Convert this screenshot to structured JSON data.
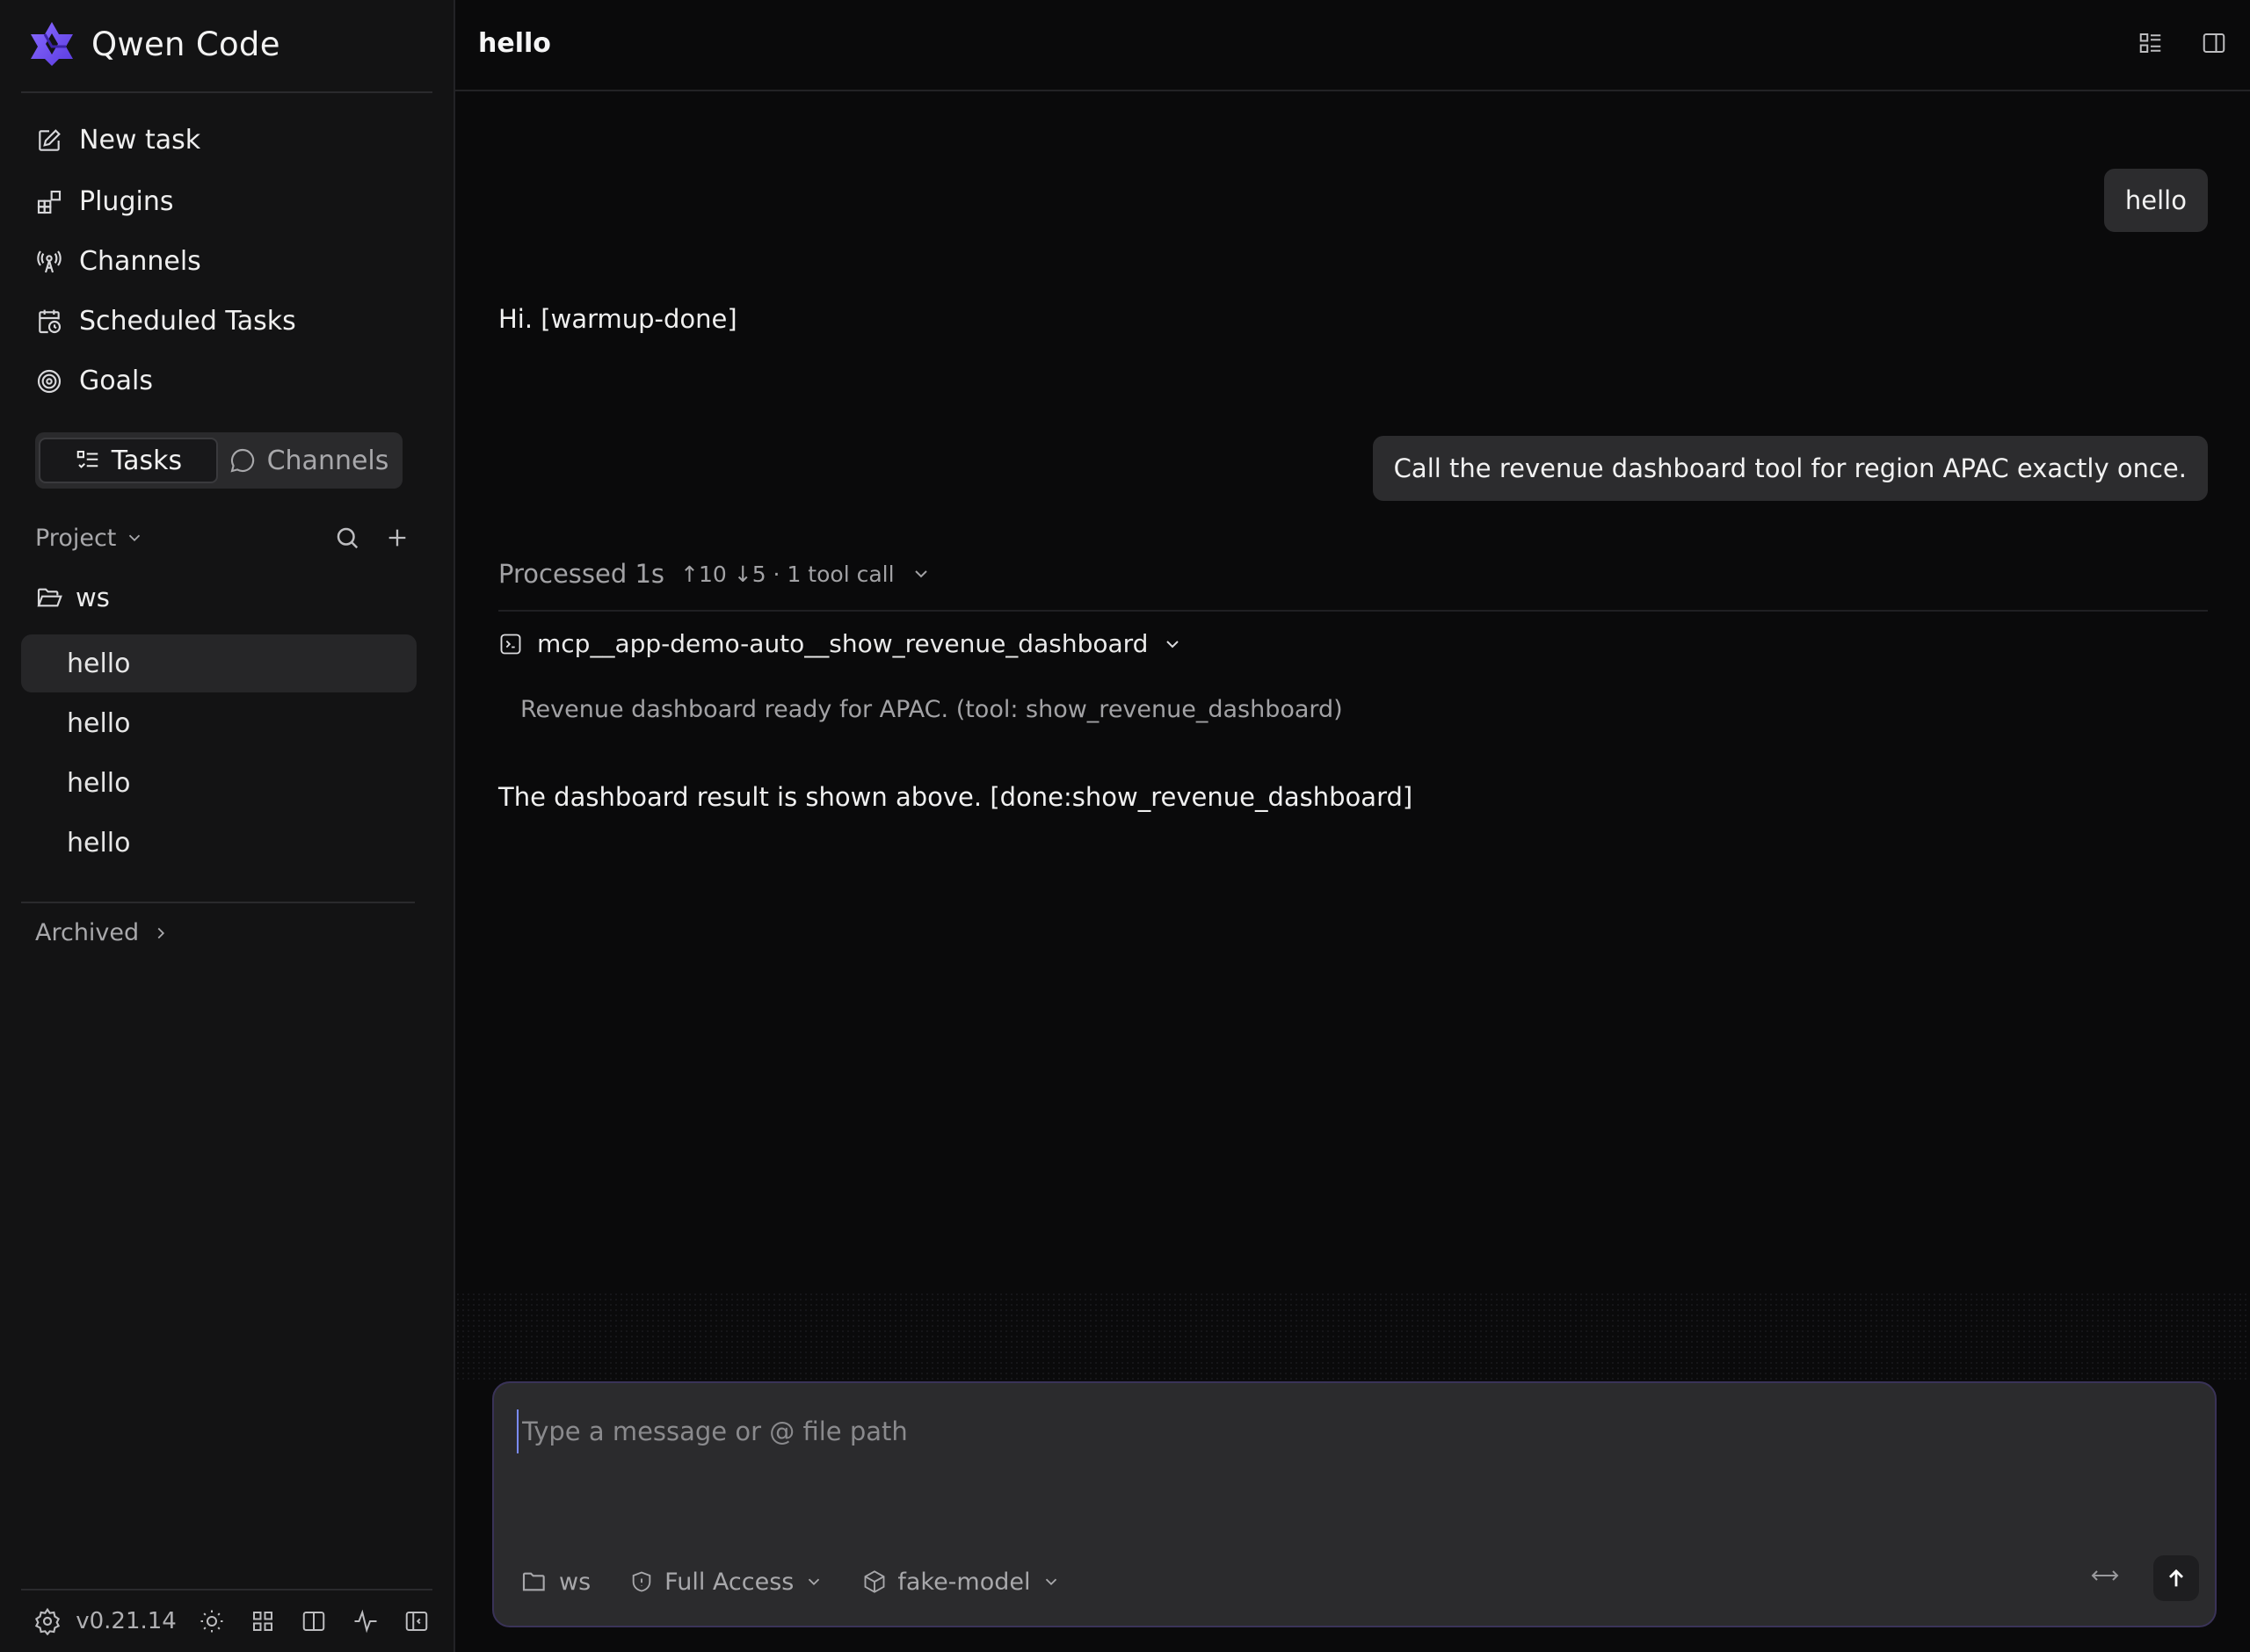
{
  "app": {
    "name": "Qwen Code",
    "version": "v0.21.14"
  },
  "sidebar": {
    "nav": [
      {
        "label": "New task",
        "icon": "edit-icon"
      },
      {
        "label": "Plugins",
        "icon": "plugin-icon"
      },
      {
        "label": "Channels",
        "icon": "broadcast-icon"
      },
      {
        "label": "Scheduled Tasks",
        "icon": "calendar-clock-icon"
      },
      {
        "label": "Goals",
        "icon": "target-icon"
      }
    ],
    "segment": {
      "tasks": "Tasks",
      "channels": "Channels",
      "active": "Tasks"
    },
    "project_label": "Project",
    "folder": "ws",
    "tasks": [
      "hello",
      "hello",
      "hello",
      "hello"
    ],
    "archived_label": "Archived"
  },
  "header": {
    "title": "hello"
  },
  "conversation": {
    "user_msg_1": "hello",
    "assistant_msg_1": "Hi. [warmup-done]",
    "user_msg_2": "Call the revenue dashboard tool for region APAC exactly once.",
    "processed_label": "Processed 1s",
    "processed_stats": "↑10 ↓5 · 1 tool call",
    "tool_name": "mcp__app-demo-auto__show_revenue_dashboard",
    "tool_output": "Revenue dashboard ready for APAC. (tool: show_revenue_dashboard)",
    "assistant_msg_2": "The dashboard result is shown above. [done:show_revenue_dashboard]"
  },
  "composer": {
    "placeholder": "Type a message or @ file path",
    "folder": "ws",
    "access": "Full Access",
    "model": "fake-model"
  },
  "colors": {
    "accent": "#7b5cff",
    "background": "#0a0a0b",
    "sidebar": "#131314",
    "bubble": "#2c2c2e"
  }
}
